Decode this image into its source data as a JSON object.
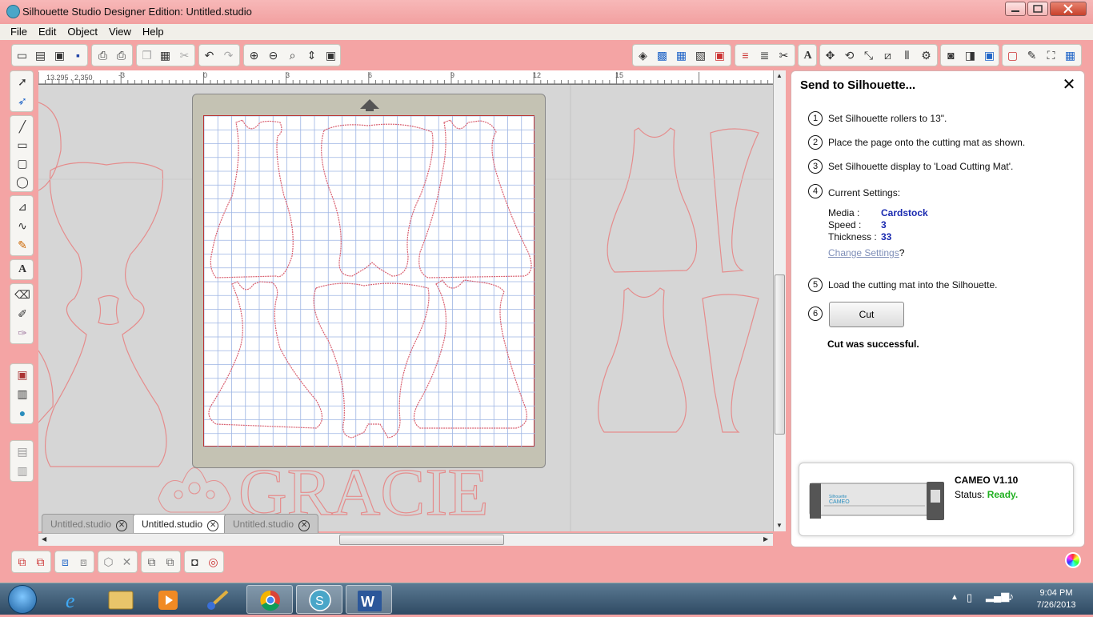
{
  "window": {
    "title": "Silhouette Studio Designer Edition: Untitled.studio"
  },
  "menu": [
    "File",
    "Edit",
    "Object",
    "View",
    "Help"
  ],
  "ruler": {
    "coords": "13.295 , 2.350",
    "h_ticks": [
      "-3",
      "0",
      "3",
      "6",
      "9",
      "12",
      "15"
    ]
  },
  "tabs": [
    {
      "label": "Untitled.studio",
      "active": false
    },
    {
      "label": "Untitled.studio",
      "active": true
    },
    {
      "label": "Untitled.studio",
      "active": false
    }
  ],
  "watermark": "GRACIE",
  "panel": {
    "title": "Send to Silhouette...",
    "steps": [
      {
        "num": "1",
        "text": "Set Silhouette rollers to 13\"."
      },
      {
        "num": "2",
        "text": "Place the page onto the cutting mat as shown."
      },
      {
        "num": "3",
        "text": "Set Silhouette display to 'Load Cutting Mat'."
      },
      {
        "num": "4",
        "text": "Current Settings:"
      },
      {
        "num": "5",
        "text": "Load the cutting mat into the Silhouette."
      },
      {
        "num": "6",
        "text": ""
      }
    ],
    "settings": {
      "media_label": "Media :",
      "media": "Cardstock",
      "speed_label": "Speed :",
      "speed": "3",
      "thickness_label": "Thickness :",
      "thickness": "33",
      "change_link": "Change Settings",
      "change_suffix": "?"
    },
    "cut_button": "Cut",
    "result": "Cut was successful.",
    "device": {
      "name": "CAMEO V1.10",
      "status_label": "Status:",
      "status": "Ready.",
      "brand": "Silhouette",
      "model": "CAMEO"
    }
  },
  "taskbar": {
    "time": "9:04 PM",
    "date": "7/26/2013"
  },
  "colors": {
    "accent": "#f4a4a4",
    "outline": "#e88080",
    "link": "#1a2ab0",
    "ready": "#21b021"
  }
}
